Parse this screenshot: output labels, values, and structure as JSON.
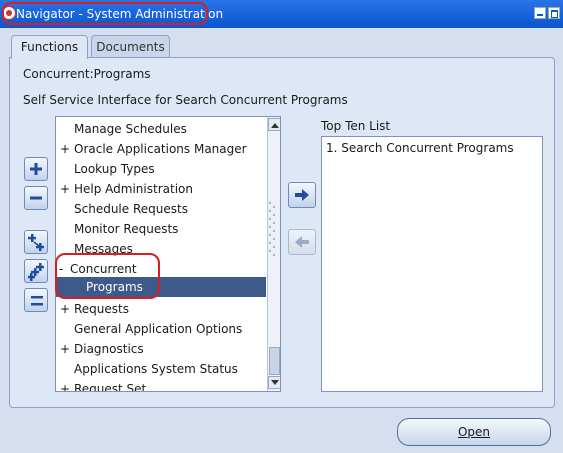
{
  "window": {
    "title": "Navigator - System Administration"
  },
  "tabs": [
    {
      "label": "Functions",
      "active": true
    },
    {
      "label": "Documents",
      "active": false
    }
  ],
  "panel": {
    "path": "Concurrent:Programs",
    "description": "Self Service Interface for Search Concurrent Programs"
  },
  "side_buttons": [
    "expand-icon",
    "collapse-icon",
    "expand-branch-icon",
    "expand-all-icon",
    "collapse-all-icon"
  ],
  "nav_items": [
    {
      "expander": "",
      "label": "Manage Schedules"
    },
    {
      "expander": "+",
      "label": "Oracle Applications Manager"
    },
    {
      "expander": "",
      "label": "Lookup Types"
    },
    {
      "expander": "+",
      "label": "Help Administration"
    },
    {
      "expander": "",
      "label": "Schedule Requests"
    },
    {
      "expander": "",
      "label": "Monitor Requests"
    },
    {
      "expander": "",
      "label": "Messages"
    },
    {
      "expander": "-",
      "label": "Concurrent"
    },
    {
      "expander": "",
      "label": "Programs"
    },
    {
      "expander": "+",
      "label": "Requests"
    },
    {
      "expander": "",
      "label": "General Application Options"
    },
    {
      "expander": "+",
      "label": "Diagnostics"
    },
    {
      "expander": "",
      "label": "Applications System Status"
    },
    {
      "expander": "+",
      "label": "Request Set"
    }
  ],
  "selected_index": 8,
  "top_ten": {
    "title": "Top Ten List",
    "items": [
      "1. Search Concurrent Programs"
    ]
  },
  "buttons": {
    "open_label": "Open"
  },
  "colors": {
    "titlebar": "#0a55cf",
    "selection": "#3d5a8a",
    "highlight_circle": "#d81f1f",
    "background": "#d6dfef"
  }
}
